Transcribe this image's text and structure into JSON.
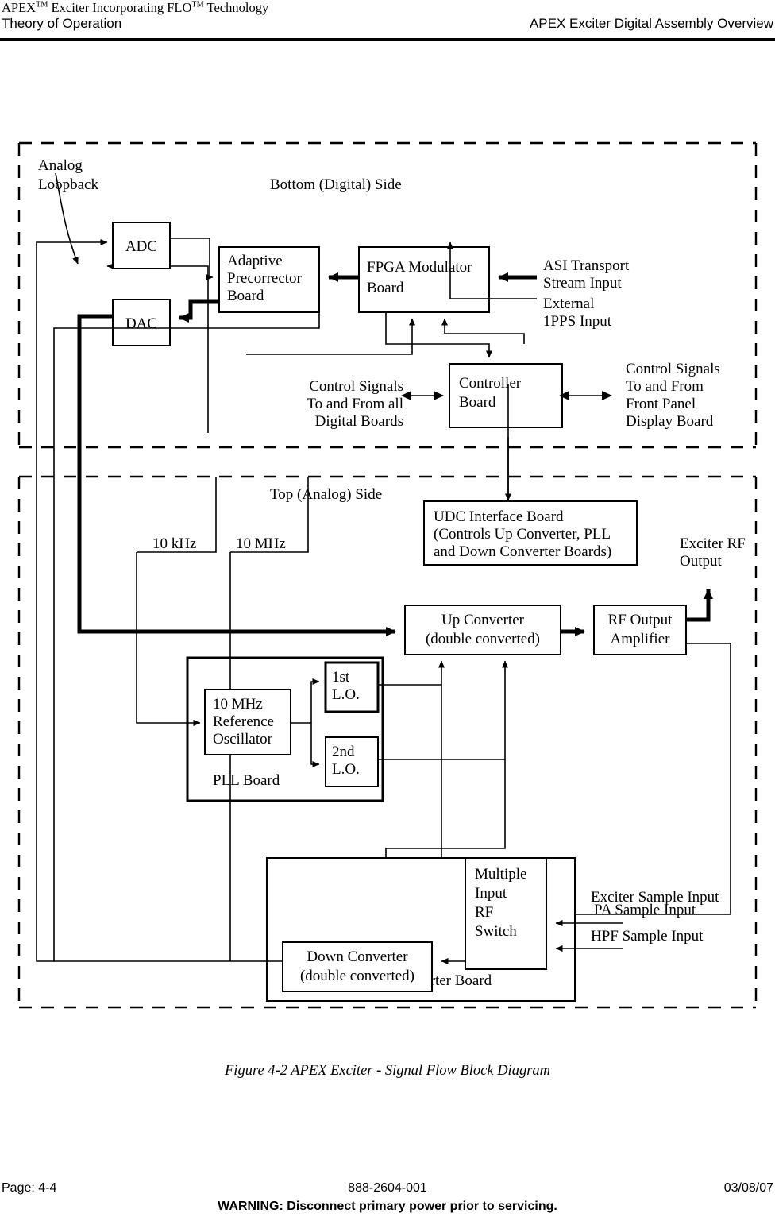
{
  "header": {
    "title_line1_pre": "APEX",
    "title_line1_sup1": "TM",
    "title_line1_mid": " Exciter Incorporating FLO",
    "title_line1_sup2": "TM",
    "title_line1_post": " Technology",
    "left": "Theory of Operation",
    "right": "APEX Exciter Digital Assembly Overview"
  },
  "caption": "Figure 4-2  APEX Exciter - Signal Flow Block Diagram",
  "footer": {
    "page": "Page: 4-4",
    "part_number": "888-2604-001",
    "date": "03/08/07",
    "warning": "WARNING: Disconnect primary power prior to servicing."
  },
  "diagram": {
    "section_titles": {
      "bottom": "Bottom (Digital) Side",
      "top": "Top (Analog) Side"
    },
    "blocks": {
      "adc": "ADC",
      "dac": "DAC",
      "adaptive_precorrector": [
        "Adaptive",
        "Precorrector",
        "Board"
      ],
      "fpga_modulator": [
        "FPGA Modulator",
        "Board"
      ],
      "controller": [
        "Controller",
        "Board"
      ],
      "udc_interface": [
        "UDC Interface Board",
        "(Controls Up Converter, PLL",
        "and Down Converter Boards)"
      ],
      "up_converter": [
        "Up Converter",
        "(double converted)"
      ],
      "rf_output_amplifier": [
        "RF Output",
        "Amplifier"
      ],
      "reference_oscillator": [
        "10 MHz",
        "Reference",
        "Oscillator"
      ],
      "first_lo": [
        "1st",
        "L.O."
      ],
      "second_lo": [
        "2nd",
        "L.O."
      ],
      "pll_board": "PLL Board",
      "down_converter": [
        "Down Converter",
        "(double converted)"
      ],
      "rf_switch": [
        "Multiple",
        "Input",
        "RF",
        "Switch"
      ],
      "down_converter_board": "Down Converter Board"
    },
    "labels": {
      "analog_loopback": [
        "Analog",
        "Loopback"
      ],
      "external_1pps": [
        "External",
        "1PPS Input"
      ],
      "asi_transport": [
        "ASI Transport",
        "Stream Input"
      ],
      "ctrl_digital_boards": [
        "Control Signals",
        "To and From all",
        "Digital Boards"
      ],
      "ctrl_front_panel": [
        "Control Signals",
        "To and From",
        "Front Panel",
        "Display Board"
      ],
      "ten_khz": "10 kHz",
      "ten_mhz": "10 MHz",
      "exciter_rf_output": [
        "Exciter RF",
        "Output"
      ],
      "exciter_sample_input": "Exciter Sample Input",
      "pa_sample_input": "PA Sample Input",
      "hpf_sample_input": "HPF Sample Input"
    }
  }
}
